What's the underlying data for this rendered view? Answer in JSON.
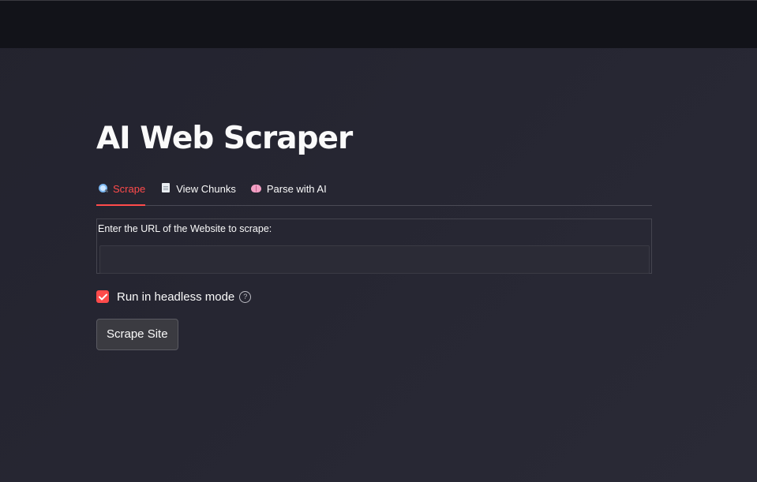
{
  "app": {
    "title": "AI Web Scraper"
  },
  "tabs": [
    {
      "label": "Scrape",
      "icon": "search-icon",
      "active": true
    },
    {
      "label": "View Chunks",
      "icon": "document-icon",
      "active": false
    },
    {
      "label": "Parse with AI",
      "icon": "brain-icon",
      "active": false
    }
  ],
  "url_field": {
    "label": "Enter the URL of the Website to scrape:",
    "value": "",
    "placeholder": ""
  },
  "headless": {
    "label": "Run in headless mode",
    "checked": true,
    "help_icon": "question-circle-icon"
  },
  "scrape_button": {
    "label": "Scrape Site"
  },
  "colors": {
    "accent": "#ff4b4b",
    "background": "#262632",
    "header": "#121319",
    "text": "#fafafa"
  }
}
